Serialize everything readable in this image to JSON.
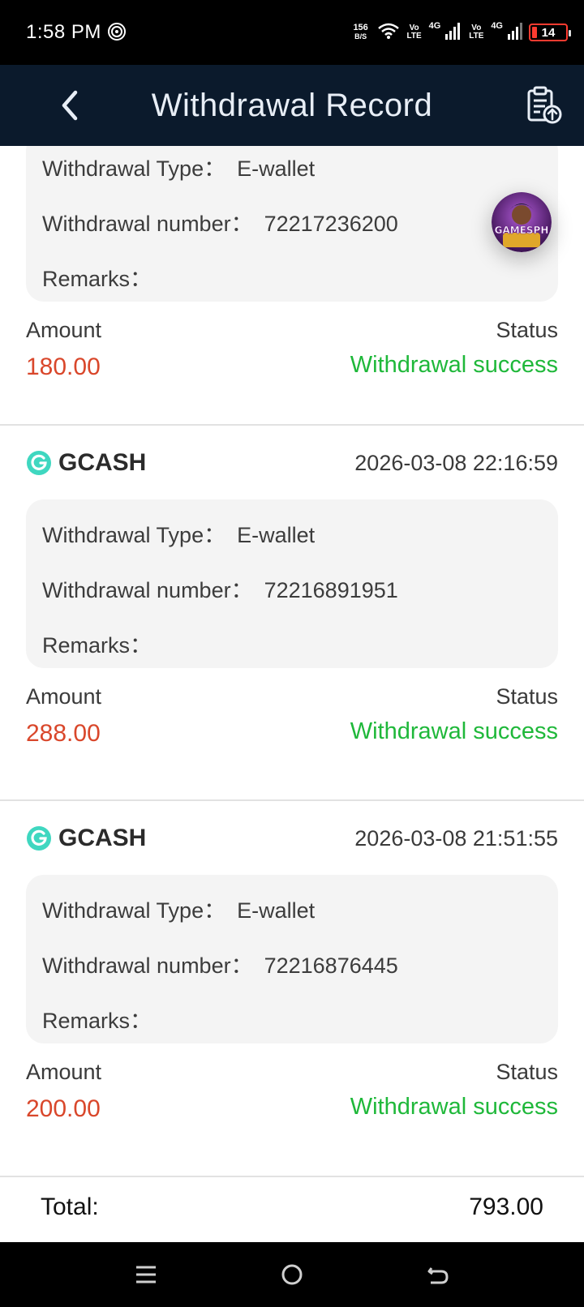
{
  "status_bar": {
    "time": "1:58 PM",
    "net_speed_value": "156",
    "net_speed_unit": "B/S",
    "volte_top": "Vo",
    "volte_bottom": "LTE",
    "network_type": "4G",
    "battery_level": "14"
  },
  "header": {
    "title": "Withdrawal Record",
    "back_icon": "chevron-left-icon",
    "action_icon": "clipboard-upload-icon"
  },
  "floating_button": {
    "label": "GAMESPH"
  },
  "labels": {
    "withdrawal_type": "Withdrawal Type：",
    "withdrawal_number": "Withdrawal number：",
    "remarks": "Remarks：",
    "amount": "Amount",
    "status": "Status"
  },
  "records": [
    {
      "provider": "",
      "date": "",
      "withdrawal_type": "E-wallet",
      "withdrawal_number": "72217236200",
      "remarks": "",
      "amount": "180.00",
      "status": "Withdrawal success"
    },
    {
      "provider": "GCASH",
      "date": "2026-03-08 22:16:59",
      "withdrawal_type": "E-wallet",
      "withdrawal_number": "72216891951",
      "remarks": "",
      "amount": "288.00",
      "status": "Withdrawal success"
    },
    {
      "provider": "GCASH",
      "date": "2026-03-08 21:51:55",
      "withdrawal_type": "E-wallet",
      "withdrawal_number": "72216876445",
      "remarks": "",
      "amount": "200.00",
      "status": "Withdrawal success"
    }
  ],
  "total": {
    "label": "Total:",
    "value": "793.00"
  },
  "colors": {
    "header_bg": "#0b1a2c",
    "amount": "#d9472b",
    "status_success": "#1fb83a",
    "gcash_icon": "#3fd7c0"
  },
  "nav": {
    "icons": [
      "menu-icon",
      "home-icon",
      "back-icon"
    ]
  }
}
